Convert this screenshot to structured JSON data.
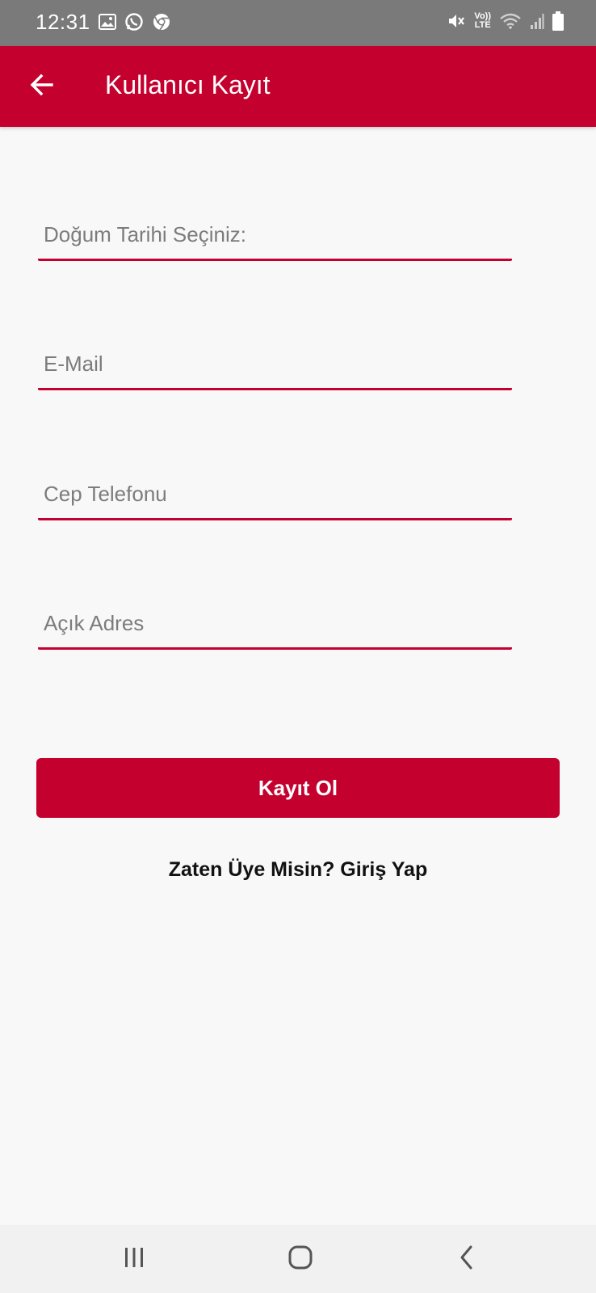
{
  "status_bar": {
    "time": "12:31",
    "left_icons": [
      "gallery-icon",
      "whatsapp-icon",
      "chrome-icon"
    ],
    "right_icons": [
      "mute-icon",
      "volte-icon",
      "wifi-icon",
      "signal-icon",
      "battery-icon"
    ],
    "volte_top": "Vo))",
    "volte_bottom": "LTE"
  },
  "app_bar": {
    "title": "Kullanıcı Kayıt",
    "back_icon": "arrow-left-icon",
    "background": "#c4002e"
  },
  "form": {
    "birth_date_placeholder": "Doğum Tarihi Seçiniz:",
    "email_placeholder": "E-Mail",
    "phone_placeholder": "Cep Telefonu",
    "address_placeholder": "Açık Adres",
    "underline_color": "#c4002e"
  },
  "actions": {
    "register_label": "Kayıt Ol",
    "login_link": "Zaten Üye Misin? Giriş Yap"
  },
  "nav_bar": {
    "icons": [
      "recents-icon",
      "home-icon",
      "back-icon"
    ]
  }
}
